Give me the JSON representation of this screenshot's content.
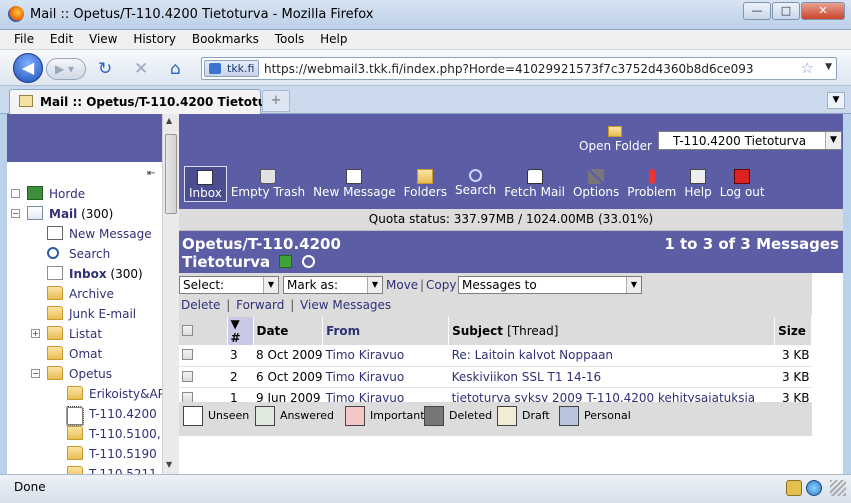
{
  "window": {
    "title": "Mail :: Opetus/T-110.4200 Tietoturva - Mozilla Firefox"
  },
  "menubar": [
    "File",
    "Edit",
    "View",
    "History",
    "Bookmarks",
    "Tools",
    "Help"
  ],
  "navbar": {
    "site_id": "tkk.fi",
    "url": "https://webmail3.tkk.fi/index.php?Horde=41029921573f7c3752d4360b8d6ce093"
  },
  "tab": {
    "title": "Mail :: Opetus/T-110.4200 Tietoturva"
  },
  "sidebar": {
    "items": [
      {
        "label": "Horde",
        "expander": "□",
        "icon": "horde-icon",
        "level": 0
      },
      {
        "label": "Mail",
        "count": "(300)",
        "expander": "⊟",
        "icon": "mail-icon",
        "level": 0,
        "bold": true
      },
      {
        "label": "New Message",
        "icon": "new-message-icon",
        "level": 1
      },
      {
        "label": "Search",
        "icon": "search-icon",
        "level": 1
      },
      {
        "label": "Inbox",
        "count": "(300)",
        "icon": "inbox-icon",
        "level": 1,
        "bold": true
      },
      {
        "label": "Archive",
        "icon": "folder-icon",
        "level": 1
      },
      {
        "label": "Junk E-mail",
        "icon": "folder-icon",
        "level": 1
      },
      {
        "label": "Listat",
        "expander": "⊞",
        "icon": "folder-icon",
        "level": 1
      },
      {
        "label": "Omat",
        "icon": "folder-icon",
        "level": 1
      },
      {
        "label": "Opetus",
        "expander": "⊟",
        "icon": "folder-icon",
        "level": 1
      },
      {
        "label": "Erikoisty&AP",
        "icon": "folder-icon",
        "level": 2
      },
      {
        "label": "T-110.4200",
        "icon": "folder-icon",
        "level": 2,
        "selected": true
      },
      {
        "label": "T-110.5100,",
        "icon": "folder-icon",
        "level": 2
      },
      {
        "label": "T-110.5190",
        "icon": "folder-icon",
        "level": 2
      },
      {
        "label": "T-110.5211",
        "icon": "folder-icon",
        "level": 2
      }
    ]
  },
  "header": {
    "open_folder_label": "Open Folder",
    "folder_select_value": "T-110.4200 Tietoturva"
  },
  "toolbar": [
    {
      "label": "Inbox",
      "icon": "inbox-icon",
      "active": true
    },
    {
      "label": "Empty Trash",
      "icon": "trash-icon"
    },
    {
      "label": "New Message",
      "icon": "compose-icon"
    },
    {
      "label": "Folders",
      "icon": "folders-icon"
    },
    {
      "label": "Search",
      "icon": "search-icon"
    },
    {
      "label": "Fetch Mail",
      "icon": "fetch-mail-icon"
    },
    {
      "label": "Options",
      "icon": "options-icon"
    },
    {
      "label": "Problem",
      "icon": "problem-icon"
    },
    {
      "label": "Help",
      "icon": "help-icon"
    },
    {
      "label": "Log out",
      "icon": "logout-icon"
    }
  ],
  "quota": "Quota status: 337.97MB / 1024.00MB (33.01%)",
  "mailbox": {
    "title_line1": "Opetus/T-110.4200",
    "title_line2": "Tietoturva",
    "count": "1 to 3 of 3 Messages"
  },
  "actions": {
    "select_value": "Select:",
    "mark_as_value": "Mark as:",
    "move": "Move",
    "copy": "Copy",
    "messages_to_value": "Messages to",
    "delete": "Delete",
    "forward": "Forward",
    "view_messages": "View Messages"
  },
  "table": {
    "columns": {
      "sort_arrow": "▼",
      "number": "#",
      "date": "Date",
      "from": "From",
      "subject": "Subject",
      "thread": "[Thread]",
      "size": "Size"
    },
    "rows": [
      {
        "number": "3",
        "date": "8 Oct 2009",
        "from": "Timo Kiravuo",
        "subject": "Re: Laitoin kalvot Noppaan",
        "size": "3 KB"
      },
      {
        "number": "2",
        "date": "6 Oct 2009",
        "from": "Timo Kiravuo",
        "subject": "Keskiviikon SSL T1 14-16",
        "size": "3 KB"
      },
      {
        "number": "1",
        "date": "9 Jun 2009",
        "from": "Timo Kiravuo",
        "subject": "tietoturva syksy 2009 T-110.4200 kehitysajatuksia",
        "size": "3 KB"
      }
    ]
  },
  "legend": [
    {
      "label": "Unseen",
      "icon": "unseen-icon"
    },
    {
      "label": "Answered",
      "icon": "answered-icon"
    },
    {
      "label": "Important",
      "icon": "important-icon"
    },
    {
      "label": "Deleted",
      "icon": "deleted-icon"
    },
    {
      "label": "Draft",
      "icon": "draft-icon"
    },
    {
      "label": "Personal",
      "icon": "personal-icon"
    }
  ],
  "status": {
    "text": "Done"
  }
}
